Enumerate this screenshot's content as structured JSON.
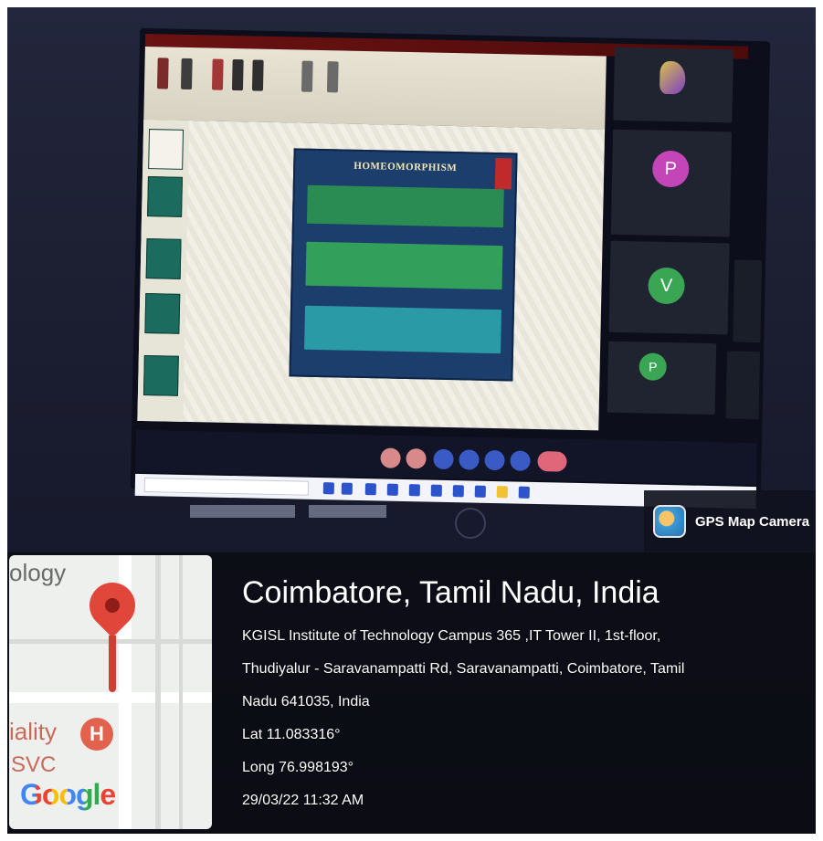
{
  "photo": {
    "description_colors": {
      "screen_bg": "#0c0e1c",
      "panel_bg": "#0a0b12"
    },
    "slide": {
      "title": "HOMEOMORPHISM"
    },
    "gps_badge": {
      "label": "GPS Map Camera",
      "icon": "gps-camera-icon"
    },
    "map": {
      "label_top": "ology",
      "label_left": "iality",
      "label_left2": "SVC",
      "hospital_glyph": "H",
      "brand": "Google",
      "pin_icon": "map-pin-icon"
    },
    "location": {
      "title": "Coimbatore, Tamil Nadu, India",
      "address_line1": "KGISL Institute of Technology Campus 365 ,IT Tower II, 1st-floor,",
      "address_line2": "Thudiyalur - Saravanampatti Rd, Saravanampatti, Coimbatore, Tamil",
      "address_line3": "Nadu 641035, India",
      "lat": "Lat 11.083316°",
      "long": "Long 76.998193°",
      "datetime": "29/03/22 11:32 AM"
    }
  }
}
